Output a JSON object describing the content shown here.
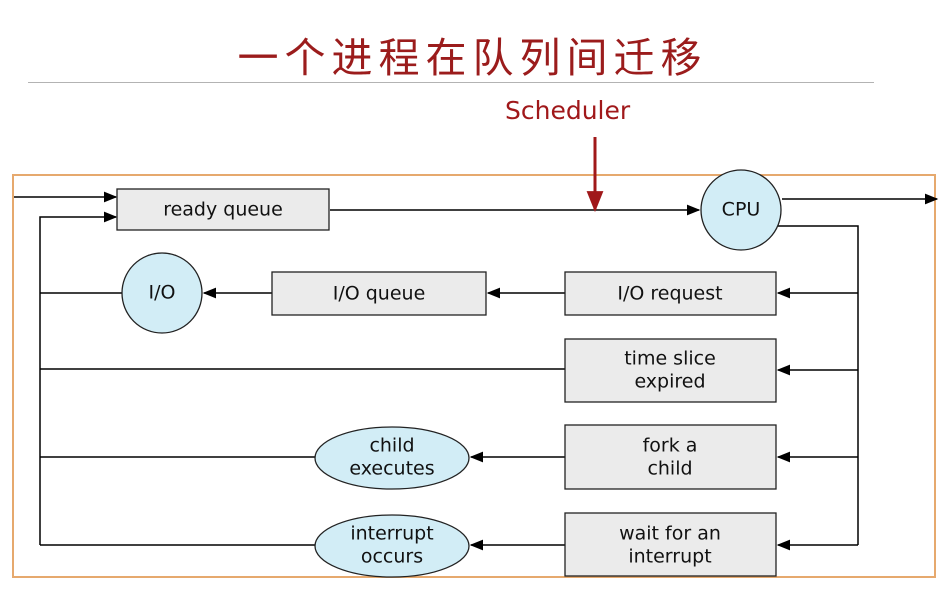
{
  "title": "一个进程在队列间迁移",
  "scheduler_label": "Scheduler",
  "nodes": {
    "ready_queue": "ready queue",
    "cpu": "CPU",
    "io": "I/O",
    "io_queue": "I/O queue",
    "io_request": "I/O request",
    "time_slice_line1": "time slice",
    "time_slice_line2": "expired",
    "fork_line1": "fork a",
    "fork_line2": "child",
    "child_exec_line1": "child",
    "child_exec_line2": "executes",
    "wait_line1": "wait for an",
    "wait_line2": "interrupt",
    "interrupt_line1": "interrupt",
    "interrupt_line2": "occurs"
  },
  "colors": {
    "title": "#9b1c1c",
    "scheduler": "#a0181a",
    "frame_border": "#e6a96e",
    "box_fill": "#ebebeb",
    "circle_fill": "#d2edf6"
  }
}
